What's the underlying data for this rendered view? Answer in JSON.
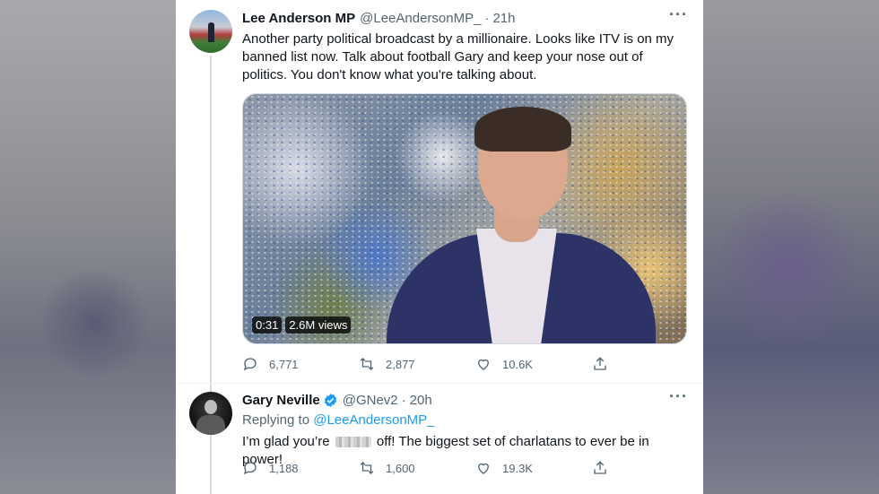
{
  "tweet1": {
    "display_name": "Lee Anderson MP",
    "handle": "@LeeAndersonMP_",
    "separator": "·",
    "time": "21h",
    "text": "Another party political broadcast by a millionaire. Looks like ITV is on my banned list now. Talk about football Gary and keep your nose out of politics. You don't know what you're talking about.",
    "video": {
      "duration": "0:31",
      "views": "2.6M views"
    },
    "stats": {
      "replies": "6,771",
      "retweets": "2,877",
      "likes": "10.6K"
    }
  },
  "tweet2": {
    "display_name": "Gary Neville",
    "handle": "@GNev2",
    "separator": "·",
    "time": "20h",
    "replying_prefix": "Replying to",
    "replying_to": "@LeeAndersonMP_",
    "text_before": "I’m glad you’re",
    "text_after": "off! The biggest set of charlatans to ever be in power!",
    "stats": {
      "replies": "1,188",
      "retweets": "1,600",
      "likes": "19.3K"
    }
  },
  "colors": {
    "accent": "#1d9bf0",
    "text": "#0f1419",
    "muted": "#536471",
    "thread": "#cfd9de"
  },
  "icons": [
    "reply-icon",
    "retweet-icon",
    "like-icon",
    "share-icon",
    "more-icon",
    "verified-icon"
  ]
}
